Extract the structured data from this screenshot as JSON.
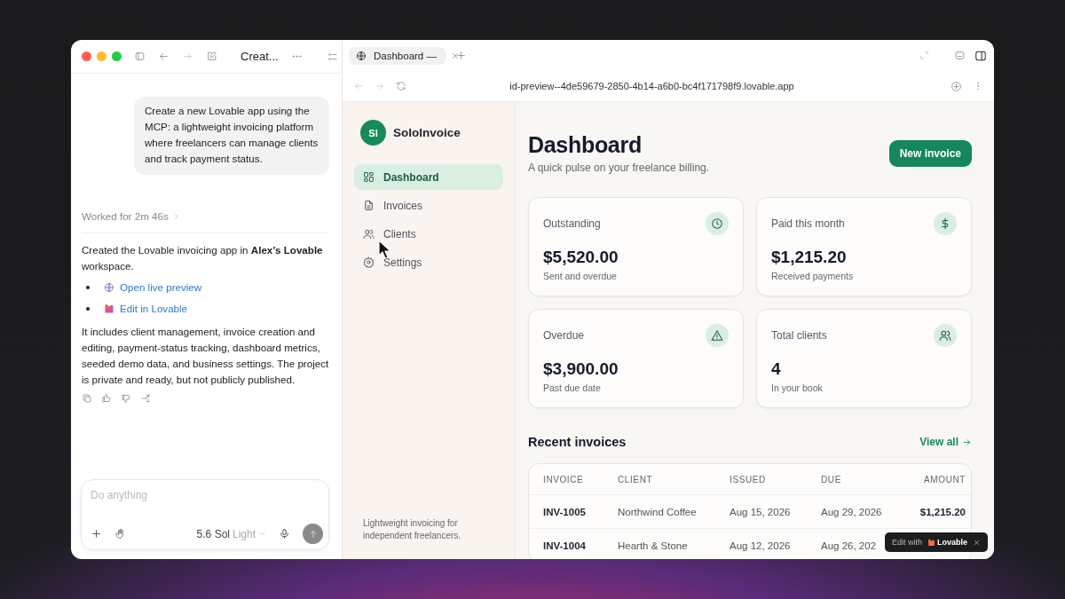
{
  "chat": {
    "title": "Creat...",
    "user_message": "Create a new Lovable app using the MCP: a lightweight invoicing platform where freelancers can manage clients and track payment status.",
    "worked_for": "Worked for 2m 46s",
    "reply": "Created the Lovable invoicing app in **Alex’s Lovable** workspace.",
    "links": [
      "Open live preview",
      "Edit in Lovable"
    ],
    "summary": "It includes client management, invoice creation and editing, payment-status tracking, dashboard metrics, seeded demo data, and business settings. The project is private and ready, but not publicly published.",
    "composer": {
      "placeholder": "Do anything",
      "model": "5.6 Sol",
      "mode": "Light"
    }
  },
  "browser": {
    "tab": "Dashboard —",
    "url": "id-preview--4de59679-2850-4b14-a6b0-bc4f171798f9.lovable.app"
  },
  "app": {
    "brand_initials": "SI",
    "brand": "SoloInvoice",
    "nav": [
      {
        "label": "Dashboard",
        "selected": true
      },
      {
        "label": "Invoices",
        "selected": false
      },
      {
        "label": "Clients",
        "selected": false
      },
      {
        "label": "Settings",
        "selected": false
      }
    ],
    "tagline": "Lightweight invoicing for independent freelancers.",
    "title": "Dashboard",
    "subtitle": "A quick pulse on your freelance billing.",
    "new_button": "New invoice",
    "stats": [
      {
        "label": "Outstanding",
        "value": "$5,520.00",
        "note": "Sent and overdue"
      },
      {
        "label": "Paid this month",
        "value": "$1,215.20",
        "note": "Received payments"
      },
      {
        "label": "Overdue",
        "value": "$3,900.00",
        "note": "Past due date"
      },
      {
        "label": "Total clients",
        "value": "4",
        "note": "In your book"
      }
    ],
    "recent_title": "Recent invoices",
    "view_all": "View all",
    "columns": [
      "INVOICE",
      "CLIENT",
      "ISSUED",
      "DUE",
      "AMOUNT"
    ],
    "rows": [
      {
        "invoice": "INV-1005",
        "client": "Northwind Coffee",
        "issued": "Aug 15, 2026",
        "due": "Aug 29, 2026",
        "amount": "$1,215.20"
      },
      {
        "invoice": "INV-1004",
        "client": "Hearth & Stone",
        "issued": "Aug 12, 2026",
        "due": "Aug 26, 202"
      }
    ]
  },
  "toast": {
    "label": "Edit with",
    "brand": "Lovable"
  }
}
